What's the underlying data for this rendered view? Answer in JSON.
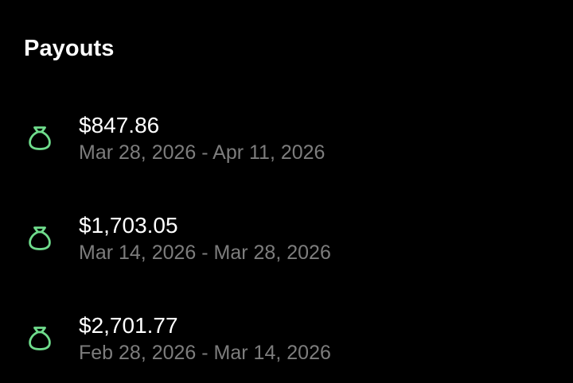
{
  "header": {
    "title": "Payouts"
  },
  "colors": {
    "background": "#000000",
    "primary_text": "#ffffff",
    "secondary_text": "#7d7d7d",
    "icon_accent": "#6fdc8c"
  },
  "payouts": [
    {
      "icon": "money-bag-icon",
      "amount": "$847.86",
      "range": "Mar 28, 2026 - Apr 11, 2026"
    },
    {
      "icon": "money-bag-icon",
      "amount": "$1,703.05",
      "range": "Mar 14, 2026 - Mar 28, 2026"
    },
    {
      "icon": "money-bag-icon",
      "amount": "$2,701.77",
      "range": "Feb 28, 2026 - Mar 14, 2026"
    }
  ]
}
